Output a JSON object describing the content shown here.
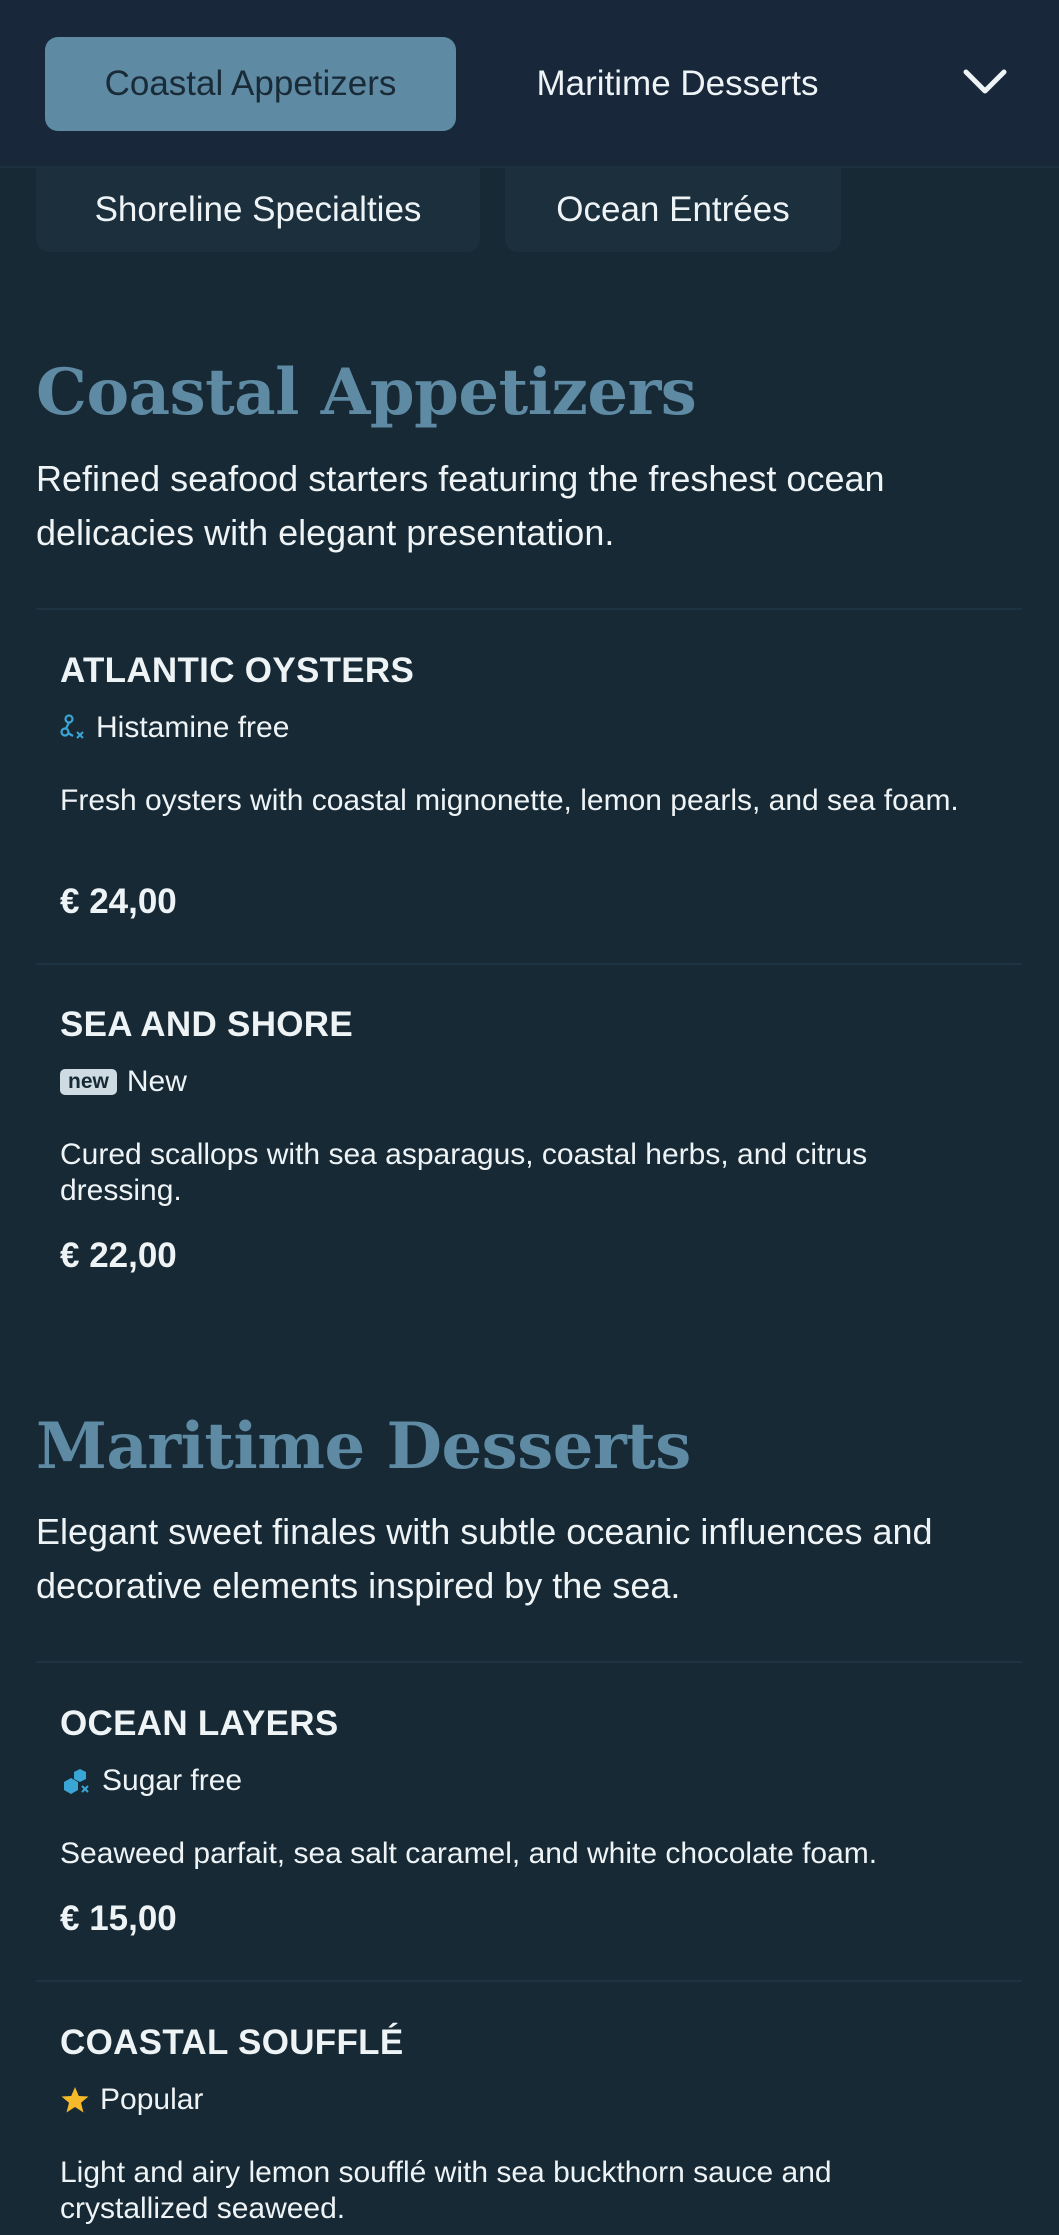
{
  "nav": {
    "tabs": [
      {
        "label": "Coastal Appetizers",
        "active": true
      },
      {
        "label": "Maritime Desserts",
        "active": false
      }
    ],
    "overflow_tabs": [
      {
        "label": "Shoreline Specialties"
      },
      {
        "label": "Ocean Entrées"
      }
    ],
    "expand_icon": "chevron-down-icon"
  },
  "sections": [
    {
      "title": "Coastal Appetizers",
      "description": "Refined seafood starters featuring the freshest ocean delicacies with elegant presentation.",
      "items": [
        {
          "name": "ATLANTIC OYSTERS",
          "tag": {
            "icon": "histamine-free-icon",
            "label": "Histamine free"
          },
          "description": "Fresh oysters with coastal mignonette, lemon pearls, and sea foam.",
          "price": "€ 24,00"
        },
        {
          "name": "SEA AND SHORE",
          "tag": {
            "icon": "new-badge-icon",
            "badge": "new",
            "label": "New"
          },
          "description": "Cured scallops with sea asparagus, coastal herbs, and citrus dressing.",
          "price": "€ 22,00"
        }
      ]
    },
    {
      "title": "Maritime Desserts",
      "description": "Elegant sweet finales with subtle oceanic influences and decorative elements inspired by the sea.",
      "items": [
        {
          "name": "OCEAN LAYERS",
          "tag": {
            "icon": "sugar-free-icon",
            "label": "Sugar free"
          },
          "description": "Seaweed parfait, sea salt caramel, and white chocolate foam.",
          "price": "€ 15,00"
        },
        {
          "name": "COASTAL SOUFFLÉ",
          "tag": {
            "icon": "star-icon",
            "label": "Popular"
          },
          "description": "Light and airy lemon soufflé with sea buckthorn sauce and crystallized seaweed."
        }
      ]
    }
  ],
  "colors": {
    "background": "#172934",
    "accent": "#5e8aa4",
    "icon_blue": "#3aa6d6",
    "star": "#f5b92a"
  }
}
